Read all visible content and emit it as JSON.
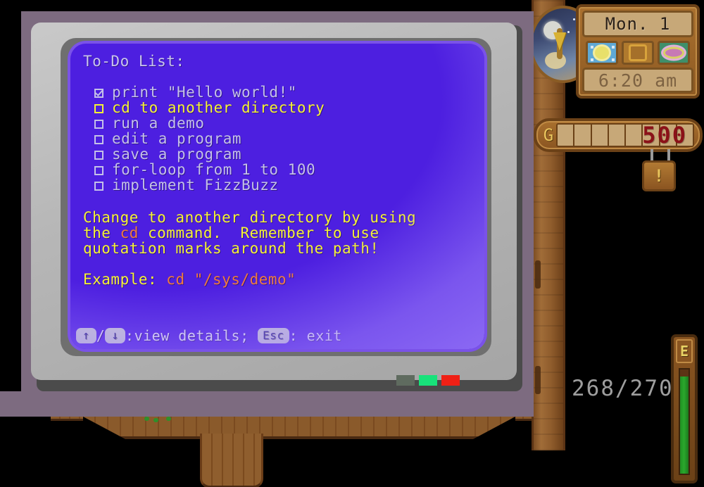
{
  "terminal": {
    "title": "To-Do List:",
    "todos": [
      {
        "label": "print \"Hello world!\"",
        "checked": true,
        "selected": false
      },
      {
        "label": "cd to another directory",
        "checked": false,
        "selected": true
      },
      {
        "label": "run a demo",
        "checked": false,
        "selected": false
      },
      {
        "label": "edit a program",
        "checked": false,
        "selected": false
      },
      {
        "label": "save a program",
        "checked": false,
        "selected": false
      },
      {
        "label": "for-loop from 1 to 100",
        "checked": false,
        "selected": false
      },
      {
        "label": "implement FizzBuzz",
        "checked": false,
        "selected": false
      }
    ],
    "hint": {
      "line1_a": "Change to another directory by using",
      "line2_a": "the ",
      "line2_kw": "cd",
      "line2_b": " command.  Remember to use",
      "line3_a": "quotation marks around the path!"
    },
    "example": {
      "label": "Example: ",
      "command": "cd \"/sys/demo\""
    },
    "statusbar": {
      "key_up": "↑",
      "sep": "/",
      "key_down": "↓",
      "action_view": ":view details; ",
      "key_esc": "Esc",
      "action_exit": ": exit"
    },
    "colors": {
      "screen_bg": "#4d1fe0",
      "screen_glow": "#7a52e8",
      "text": "#c4c0e8",
      "highlight": "#f5f235",
      "keyword": "#f07a3c"
    }
  },
  "hud": {
    "date": "Mon. 1",
    "time": "6:20 am",
    "icons": [
      {
        "name": "weather-sunny-icon"
      },
      {
        "name": "season-medallion-icon"
      },
      {
        "name": "item-ring-icon"
      }
    ],
    "gold": {
      "currency_symbol": "G",
      "amount": "500",
      "slot_count": 5
    },
    "hanging_sign": "!",
    "energy": {
      "label": "E",
      "fill_percent": 93
    },
    "health": "268/270"
  },
  "leds": [
    {
      "name": "led-off",
      "color": "#5f6b5f"
    },
    {
      "name": "led-green",
      "color": "#18e27a"
    },
    {
      "name": "led-red",
      "color": "#ef2015"
    }
  ]
}
